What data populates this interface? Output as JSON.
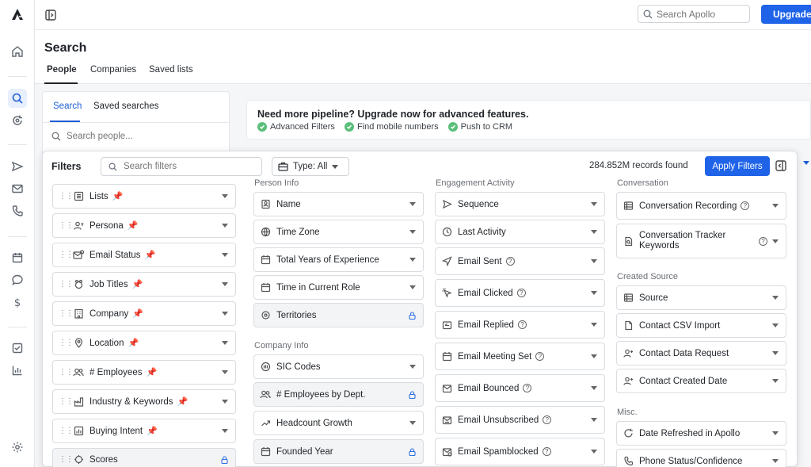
{
  "topbar": {
    "search_placeholder": "Search Apollo",
    "upgrade_label": "Upgrade"
  },
  "page": {
    "title": "Search",
    "tabs": [
      "People",
      "Companies",
      "Saved lists"
    ]
  },
  "search_panel": {
    "tabs": [
      "Search",
      "Saved searches"
    ],
    "placeholder": "Search people..."
  },
  "promo": {
    "title": "Need more pipeline? Upgrade now for advanced features.",
    "features": [
      "Advanced Filters",
      "Find mobile numbers",
      "Push to CRM"
    ]
  },
  "filters": {
    "title": "Filters",
    "search_placeholder": "Search filters",
    "type_label": "Type: All",
    "records": "284.852M records found",
    "apply_label": "Apply Filters",
    "pinned": [
      {
        "label": "Lists",
        "icon": "list-icon"
      },
      {
        "label": "Persona",
        "icon": "persona-icon"
      },
      {
        "label": "Email Status",
        "icon": "email-status-icon"
      },
      {
        "label": "Job Titles",
        "icon": "job-titles-icon"
      },
      {
        "label": "Company",
        "icon": "company-icon"
      },
      {
        "label": "Location",
        "icon": "location-icon"
      },
      {
        "label": "# Employees",
        "icon": "employees-icon"
      },
      {
        "label": "Industry & Keywords",
        "icon": "industry-icon"
      },
      {
        "label": "Buying Intent",
        "icon": "buying-intent-icon"
      },
      {
        "label": "Scores",
        "icon": "scores-icon"
      }
    ],
    "person_info": {
      "label": "Person Info",
      "items": [
        "Name",
        "Time Zone",
        "Total Years of Experience",
        "Time in Current Role",
        "Territories"
      ]
    },
    "company_info": {
      "label": "Company Info",
      "items": [
        "SIC Codes",
        "# Employees by Dept.",
        "Headcount Growth",
        "Founded Year"
      ]
    },
    "engagement": {
      "label": "Engagement Activity",
      "items": [
        "Sequence",
        "Last Activity",
        "Email Sent",
        "Email Clicked",
        "Email Replied",
        "Email Meeting Set",
        "Email Bounced",
        "Email Unsubscribed",
        "Email Spamblocked"
      ]
    },
    "conversation": {
      "label": "Conversation",
      "items": [
        "Conversation Recording",
        "Conversation Tracker Keywords"
      ]
    },
    "created_source": {
      "label": "Created Source",
      "items": [
        "Source",
        "Contact CSV Import",
        "Contact Data Request",
        "Contact Created Date"
      ]
    },
    "misc": {
      "label": "Misc.",
      "items": [
        "Date Refreshed in Apollo",
        "Phone Status/Confidence"
      ]
    }
  },
  "colors": {
    "accent": "#1f63e9",
    "pin": "#e6b52e",
    "check": "#5bbf7a"
  }
}
